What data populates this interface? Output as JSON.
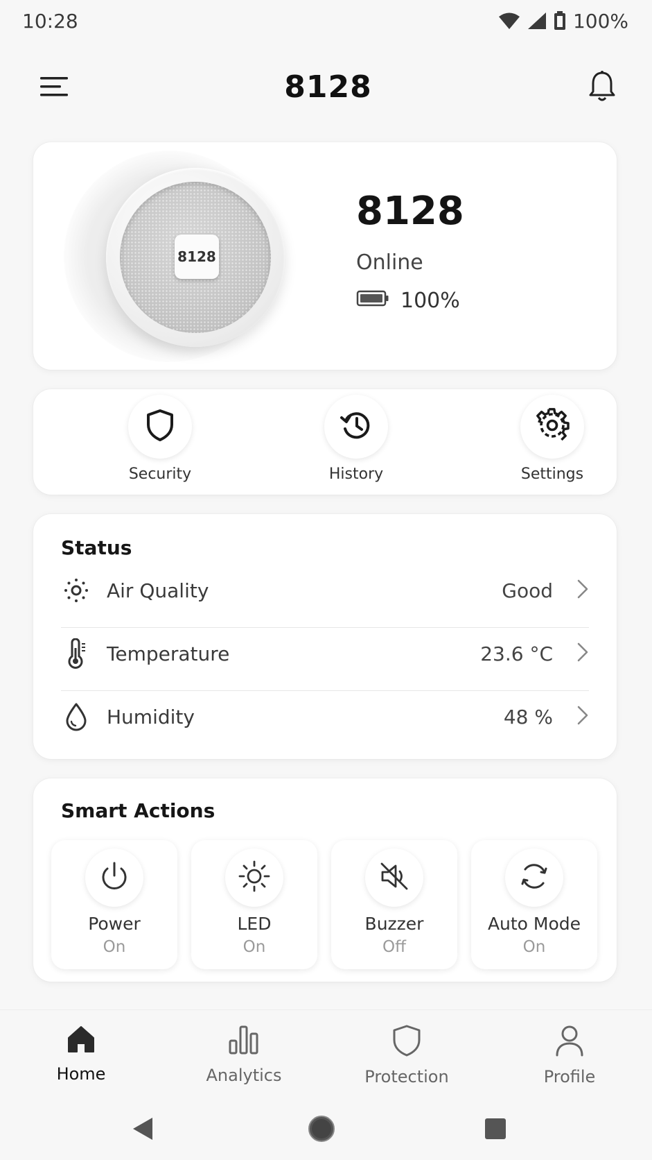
{
  "status_bar": {
    "time": "10:28",
    "battery": "100%"
  },
  "header": {
    "title": "8128",
    "menu_icon": "menu-icon",
    "bell_icon": "bell-icon"
  },
  "device": {
    "badge": "8128",
    "name": "8128",
    "status": "Online",
    "battery": "100%"
  },
  "quick_actions": [
    {
      "label": "Security",
      "icon": "shield-icon"
    },
    {
      "label": "History",
      "icon": "history-icon"
    },
    {
      "label": "Settings",
      "icon": "gear-icon"
    }
  ],
  "status": {
    "title": "Status",
    "rows": [
      {
        "label": "Air Quality",
        "value": "Good",
        "icon": "air-quality-icon"
      },
      {
        "label": "Temperature",
        "value": "23.6 °C",
        "icon": "thermometer-icon"
      },
      {
        "label": "Humidity",
        "value": "48 %",
        "icon": "droplet-icon"
      }
    ]
  },
  "smart_actions": {
    "title": "Smart Actions",
    "items": [
      {
        "name": "Power",
        "state": "On",
        "icon": "power-icon"
      },
      {
        "name": "LED",
        "state": "On",
        "icon": "sun-icon"
      },
      {
        "name": "Buzzer",
        "state": "Off",
        "icon": "speaker-muted-icon"
      },
      {
        "name": "Auto Mode",
        "state": "On",
        "icon": "refresh-icon"
      }
    ]
  },
  "bottom_nav": [
    {
      "label": "Home",
      "icon": "home-icon",
      "active": true
    },
    {
      "label": "Analytics",
      "icon": "bar-chart-icon",
      "active": false
    },
    {
      "label": "Protection",
      "icon": "shield-icon",
      "active": false
    },
    {
      "label": "Profile",
      "icon": "user-icon",
      "active": false
    }
  ],
  "colors": {
    "background": "#f7f7f7",
    "card": "#ffffff",
    "text": "#1d1d1f",
    "muted": "#9a9a9a"
  }
}
